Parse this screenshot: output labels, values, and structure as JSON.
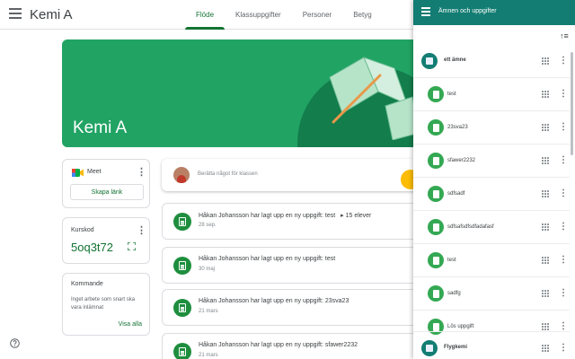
{
  "header": {
    "title": "Kemi A",
    "tabs": [
      {
        "label": "Flöde",
        "active": true
      },
      {
        "label": "Klassuppgifter",
        "active": false
      },
      {
        "label": "Personer",
        "active": false
      },
      {
        "label": "Betyg",
        "active": false
      }
    ]
  },
  "banner": {
    "title": "Kemi A"
  },
  "meet": {
    "label": "Meet",
    "button": "Skapa länk"
  },
  "class_code": {
    "label": "Kurskod",
    "value": "5oq3t72"
  },
  "upcoming": {
    "label": "Kommande",
    "text": "Inget arbete som snart ska vara inlämnat",
    "link": "Visa alla"
  },
  "announce": {
    "placeholder": "Berätta något för klassen"
  },
  "posts": [
    {
      "title": "Håkan Johansson har lagt upp en ny uppgift: test",
      "extra": "15 elever",
      "date": "28 sep."
    },
    {
      "title": "Håkan Johansson har lagt upp en ny uppgift: test",
      "date": "30 maj"
    },
    {
      "title": "Håkan Johansson har lagt upp en ny uppgift: 23sva23",
      "date": "21 mars"
    },
    {
      "title": "Håkan Johansson har lagt upp en ny uppgift: sfawer2232",
      "date": "21 mars"
    }
  ],
  "drawer": {
    "title": "Ämnen och uppgifter",
    "topics": [
      {
        "label": "ett ämne"
      },
      {
        "label": "Flygkemi"
      }
    ],
    "items": [
      {
        "label": "test"
      },
      {
        "label": "23sva23"
      },
      {
        "label": "sfawer2232"
      },
      {
        "label": "sdfsadf"
      },
      {
        "label": "sdfsafsdfsdfadafasf"
      },
      {
        "label": "test"
      },
      {
        "label": "sadfg"
      },
      {
        "label": "Lös uppgift"
      }
    ]
  },
  "colors": {
    "brand_green": "#137333",
    "banner": "#21a364",
    "drawer_header": "#137d73"
  }
}
